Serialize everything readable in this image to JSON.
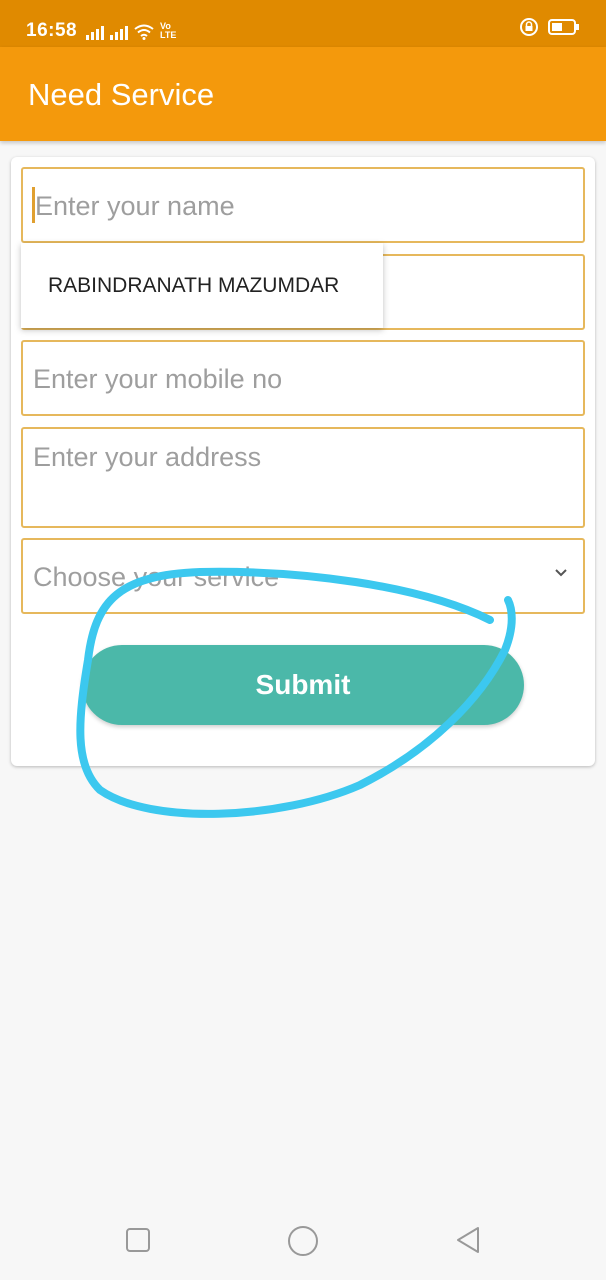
{
  "status_bar": {
    "time": "16:58",
    "network_label": "Vo LTE"
  },
  "app_bar": {
    "title": "Need Service"
  },
  "form": {
    "name_placeholder": "Enter your name",
    "mobile_placeholder": "Enter your mobile no",
    "address_placeholder": "Enter your address",
    "service_placeholder": "Choose your service",
    "autocomplete_suggestion": "RABINDRANATH MAZUMDAR",
    "submit_label": "Submit"
  },
  "colors": {
    "status_bar": "#e08a00",
    "app_bar": "#f4990c",
    "field_border": "#e6b85c",
    "submit_button": "#4bb8a9",
    "annotation_stroke": "#3cc8ef"
  },
  "icons": [
    "signal-icon",
    "wifi-icon",
    "volte-icon",
    "lock-icon",
    "battery-icon",
    "chevron-down-icon",
    "nav-recent-icon",
    "nav-home-icon",
    "nav-back-icon"
  ]
}
